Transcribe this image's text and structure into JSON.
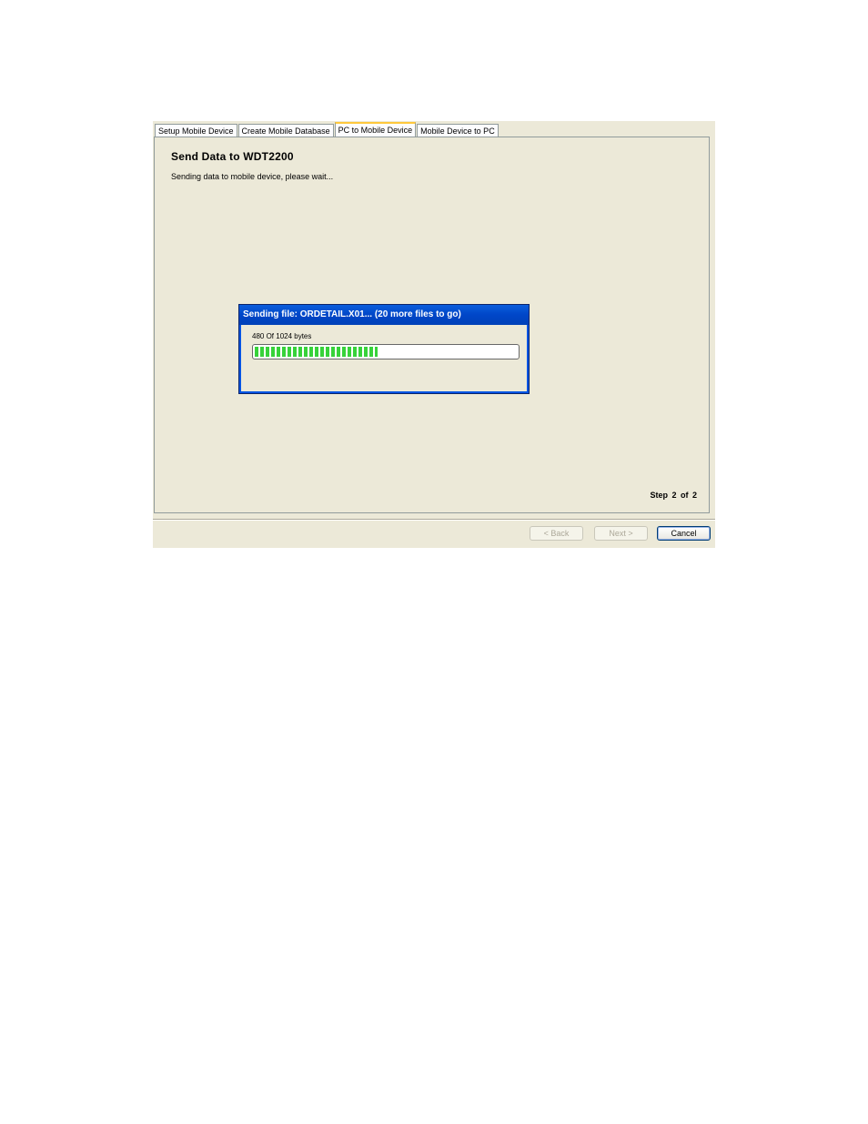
{
  "tabs": [
    {
      "label": "Setup Mobile Device",
      "active": false
    },
    {
      "label": "Create Mobile Database",
      "active": false
    },
    {
      "label": "PC to Mobile Device",
      "active": true
    },
    {
      "label": "Mobile Device to PC",
      "active": false
    }
  ],
  "page": {
    "title": "Send Data to WDT2200",
    "subtitle": "Sending data to mobile device, please wait...",
    "step": "Step  2 of  2"
  },
  "progress_dialog": {
    "title": "Sending file: ORDETAIL.X01...   (20 more files to go)",
    "bytes_text": "480 Of 1024 bytes",
    "progress_fraction": 0.47
  },
  "buttons": {
    "back": "< Back",
    "next": "Next >",
    "cancel": "Cancel"
  },
  "colors": {
    "window_bg": "#ece9d8",
    "titlebar_blue": "#0054e3",
    "progress_green": "#37d23a",
    "active_tab_accent": "#ffc83c"
  }
}
